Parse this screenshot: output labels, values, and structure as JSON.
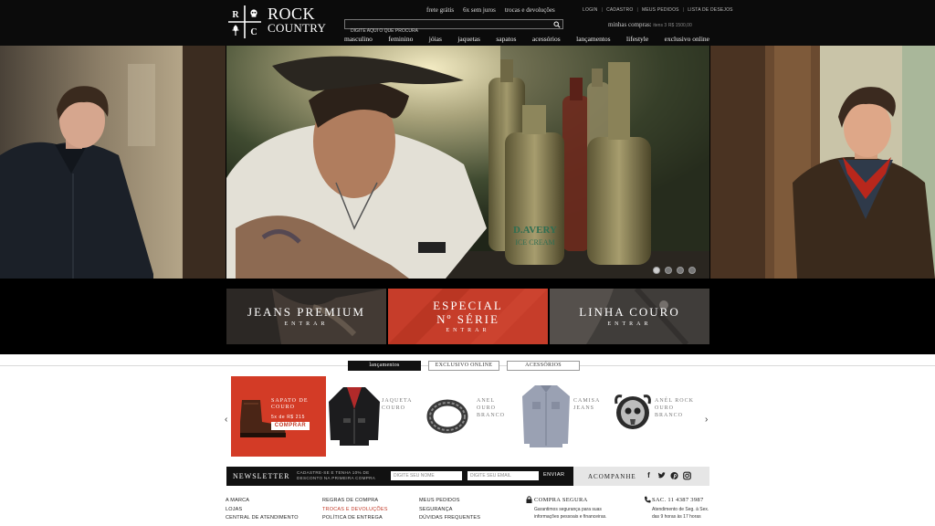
{
  "brand": {
    "line1": "ROCK",
    "line2": "COUNTRY",
    "mark_letters": [
      "R",
      "C"
    ]
  },
  "header": {
    "promos": [
      "frete grátis",
      "6x sem juros",
      "trocas e devoluções"
    ],
    "account_links": [
      "LOGIN",
      "CADASTRO",
      "MEUS PEDIDOS",
      "LISTA DE DESEJOS"
    ],
    "search_placeholder": "DIGITE AQUI O QUE PROCURA",
    "cart_label": "minhas compras:",
    "cart_items": "itens 3",
    "cart_total": "R$ 1500,00"
  },
  "nav": [
    "masculino",
    "feminino",
    "jóias",
    "jaquetas",
    "sapatos",
    "acessórios",
    "lançamentos",
    "lifestyle",
    "exclusivo online"
  ],
  "hero": {
    "slide_count": 4,
    "active_slide": 1,
    "bottle_text": "D.AVERY\nICE CREAM"
  },
  "banners": [
    {
      "title": "JEANS PREMIUM",
      "sub": "ENTRAR"
    },
    {
      "title_l1": "ESPECIAL",
      "title_l2": "Nº SÉRIE",
      "sub": "ENTRAR"
    },
    {
      "title": "LINHA COURO",
      "sub": "ENTRAR"
    }
  ],
  "tabs": [
    "lançamentos",
    "EXCLUSIVO ONLINE",
    "ACESSÓRIOS"
  ],
  "featured": {
    "l1": "SAPATO DE",
    "l2": "COURO",
    "price": "5x de R$ 215",
    "button": "COMPRAR"
  },
  "products": [
    {
      "l1": "JAQUETA",
      "l2": "COURO"
    },
    {
      "l1": "ANEL",
      "l2": "OURO",
      "l3": "BRANCO"
    },
    {
      "l1": "CAMISA",
      "l2": "JEANS"
    },
    {
      "l1": "ANÉL ROCK",
      "l2": "OURO",
      "l3": "BRANCO"
    }
  ],
  "carousel": {
    "prev": "‹",
    "next": "›"
  },
  "newsletter": {
    "title": "NEWSLETTER",
    "desc_l1": "CADASTRE-SE E TENHA 10% DE",
    "desc_l2": "DESCONTO NA PRIMEIRA COMPRA",
    "name_placeholder": "DIGITE SEU NOME",
    "email_placeholder": "DIGITE SEU EMAIL",
    "send": "ENVIAR"
  },
  "social": {
    "label": "ACOMPANHE",
    "icons": [
      "f",
      "t",
      "p",
      "ig"
    ]
  },
  "footer": {
    "col1": [
      "A MARCA",
      "LOJAS",
      "CENTRAL DE ATENDIMENTO"
    ],
    "col2": [
      "REGRAS DE COMPRA",
      "TROCAS E DEVOLUÇÕES",
      "POLÍTICA DE ENTREGA"
    ],
    "col3": [
      "MEUS PEDIDOS",
      "SEGURANÇA",
      "DÚVIDAS FREQUENTES"
    ],
    "secure_title": "COMPRA SEGURA",
    "secure_l1": "Garantimos segurança para suas",
    "secure_l2": "informações pessoais e financeiras.",
    "sac_title": "SAC. 11 4387 3987",
    "sac_l1": "Atendimento de Seg. à Sex.",
    "sac_l2": "das 9 horas às 17 horas"
  },
  "colors": {
    "accent_red": "#c23a28",
    "header_bg": "#0b0b0b"
  }
}
